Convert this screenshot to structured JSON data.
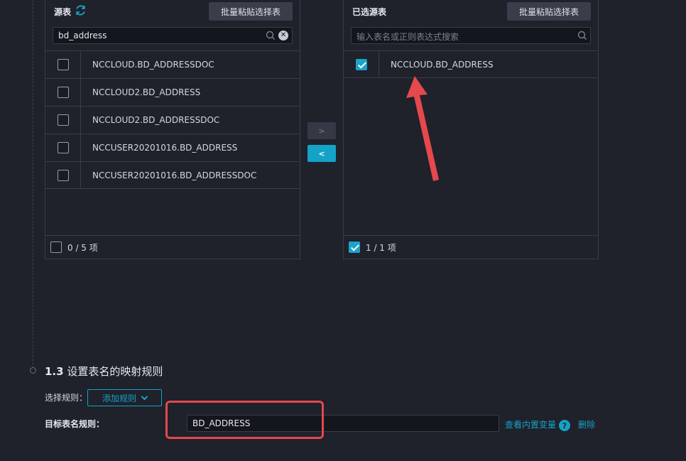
{
  "source_panel": {
    "title": "源表",
    "paste_button": "批量粘贴选择表",
    "search_value": "bd_address",
    "rows": [
      "NCCLOUD.BD_ADDRESSDOC",
      "NCCLOUD2.BD_ADDRESS",
      "NCCLOUD2.BD_ADDRESSDOC",
      "NCCUSER20201016.BD_ADDRESS",
      "NCCUSER20201016.BD_ADDRESSDOC"
    ],
    "footer_count": "0 / 5 项"
  },
  "target_panel": {
    "title": "已选源表",
    "paste_button": "批量粘贴选择表",
    "search_placeholder": "输入表名或正则表达式搜索",
    "rows": [
      "NCCLOUD.BD_ADDRESS"
    ],
    "footer_count": "1 / 1 项"
  },
  "transfer": {
    "right": ">",
    "left": "<"
  },
  "section": {
    "number": "1.3",
    "title": "设置表名的映射规则",
    "rule_label": "选择规则：",
    "add_rule": "添加规则",
    "target_label": "目标表名规则：",
    "target_value": "BD_ADDRESS",
    "view_vars": "查看内置变量",
    "help": "?",
    "delete": "删除"
  },
  "colors": {
    "accent": "#14a3c7",
    "annotation": "#e5484d",
    "background": "#1f212b"
  }
}
